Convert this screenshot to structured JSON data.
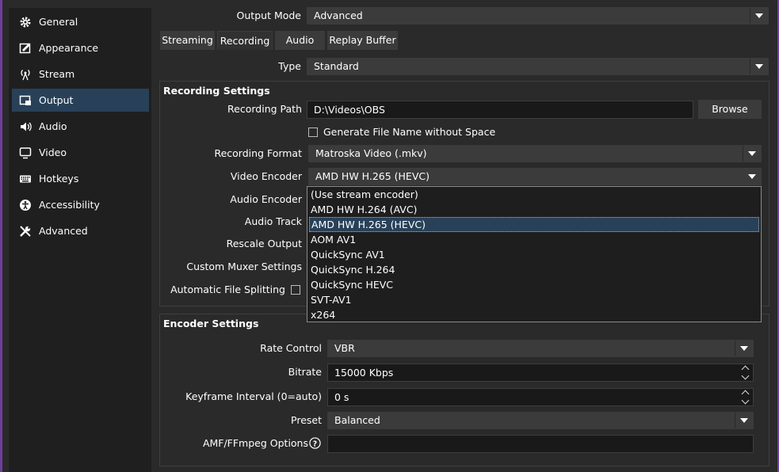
{
  "sidebar": {
    "items": [
      {
        "label": "General",
        "icon": "gear-icon"
      },
      {
        "label": "Appearance",
        "icon": "appearance-icon"
      },
      {
        "label": "Stream",
        "icon": "antenna-icon"
      },
      {
        "label": "Output",
        "icon": "output-icon",
        "selected": true
      },
      {
        "label": "Audio",
        "icon": "speaker-icon"
      },
      {
        "label": "Video",
        "icon": "monitor-icon"
      },
      {
        "label": "Hotkeys",
        "icon": "keyboard-icon"
      },
      {
        "label": "Accessibility",
        "icon": "accessibility-icon"
      },
      {
        "label": "Advanced",
        "icon": "wrench-icon"
      }
    ]
  },
  "output_mode": {
    "label": "Output Mode",
    "value": "Advanced"
  },
  "tabs": [
    {
      "label": "Streaming"
    },
    {
      "label": "Recording",
      "active": true
    },
    {
      "label": "Audio"
    },
    {
      "label": "Replay Buffer"
    }
  ],
  "type": {
    "label": "Type",
    "value": "Standard"
  },
  "recording_settings": {
    "title": "Recording Settings",
    "recording_path": {
      "label": "Recording Path",
      "value": "D:\\Videos\\OBS",
      "browse_label": "Browse"
    },
    "generate_file_name": {
      "label": "Generate File Name without Space",
      "checked": false
    },
    "recording_format": {
      "label": "Recording Format",
      "value": "Matroska Video (.mkv)"
    },
    "video_encoder": {
      "label": "Video Encoder",
      "value": "AMD HW H.265 (HEVC)"
    },
    "audio_encoder_label": "Audio Encoder",
    "audio_track_label": "Audio Track",
    "rescale_output_label": "Rescale Output",
    "custom_muxer_label": "Custom Muxer Settings",
    "auto_split": {
      "label": "Automatic File Splitting",
      "checked": false
    }
  },
  "encoder_dropdown": {
    "options": [
      "(Use stream encoder)",
      "AMD HW H.264 (AVC)",
      "AMD HW H.265 (HEVC)",
      "AOM AV1",
      "QuickSync AV1",
      "QuickSync H.264",
      "QuickSync HEVC",
      "SVT-AV1",
      "x264"
    ],
    "selected": "AMD HW H.265 (HEVC)"
  },
  "encoder_settings": {
    "title": "Encoder Settings",
    "rate_control": {
      "label": "Rate Control",
      "value": "VBR"
    },
    "bitrate": {
      "label": "Bitrate",
      "value": "15000 Kbps"
    },
    "keyframe": {
      "label": "Keyframe Interval (0=auto)",
      "value": "0 s"
    },
    "preset": {
      "label": "Preset",
      "value": "Balanced"
    },
    "amf_options": {
      "label": "AMF/FFmpeg Options",
      "value": ""
    }
  },
  "colors": {
    "accent_selected": "#284159",
    "background": "#2a2a2b",
    "window_border": "#6e3f9e"
  }
}
